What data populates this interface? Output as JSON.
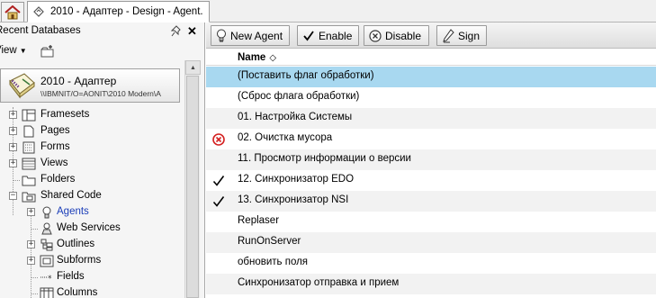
{
  "tabs": {
    "home_icon": "home-icon",
    "design_tab_label": "2010 - Адаптер - Design - Agent..."
  },
  "navigator": {
    "title": "Recent Databases",
    "view_label": "View",
    "database": {
      "name": "2010 - Адаптер",
      "path": "\\\\IBMNIT/O=AONIT\\2010 Modern\\A"
    },
    "tree": [
      {
        "label": "Framesets",
        "icon": "frameset-icon",
        "expander": "+",
        "level": 0
      },
      {
        "label": "Pages",
        "icon": "page-icon",
        "expander": "+",
        "level": 0
      },
      {
        "label": "Forms",
        "icon": "form-icon",
        "expander": "+",
        "level": 0
      },
      {
        "label": "Views",
        "icon": "view-icon",
        "expander": "+",
        "level": 0
      },
      {
        "label": "Folders",
        "icon": "folder-icon",
        "expander": "",
        "level": 0
      },
      {
        "label": "Shared Code",
        "icon": "shared-code-icon",
        "expander": "−",
        "level": 0
      },
      {
        "label": "Agents",
        "icon": "agent-bulb-icon",
        "expander": "+",
        "level": 1,
        "active": true
      },
      {
        "label": "Web Services",
        "icon": "web-services-icon",
        "expander": "",
        "level": 1
      },
      {
        "label": "Outlines",
        "icon": "outline-icon",
        "expander": "+",
        "level": 1
      },
      {
        "label": "Subforms",
        "icon": "subform-icon",
        "expander": "+",
        "level": 1
      },
      {
        "label": "Fields",
        "icon": "field-icon",
        "expander": "",
        "level": 1
      },
      {
        "label": "Columns",
        "icon": "column-icon",
        "expander": "",
        "level": 1
      }
    ]
  },
  "toolbar": {
    "new_agent": "New Agent",
    "enable": "Enable",
    "disable": "Disable",
    "sign": "Sign"
  },
  "list": {
    "column_name": "Name",
    "sort_icon": "◇",
    "rows": [
      {
        "name": "(Поставить флаг обработки)",
        "status": "",
        "selected": true
      },
      {
        "name": "(Сброс флага обработки)",
        "status": ""
      },
      {
        "name": "01. Настройка Системы",
        "status": ""
      },
      {
        "name": "02. Очистка мусора",
        "status": "disabled-icon"
      },
      {
        "name": "11. Просмотр информации о версии",
        "status": ""
      },
      {
        "name": "12. Синхронизатор EDO",
        "status": "enabled-check-icon"
      },
      {
        "name": "13. Синхронизатор NSI",
        "status": "enabled-check-icon"
      },
      {
        "name": "Replaser",
        "status": ""
      },
      {
        "name": "RunOnServer",
        "status": ""
      },
      {
        "name": "обновить поля",
        "status": ""
      },
      {
        "name": "Синхронизатор отправка и прием",
        "status": ""
      }
    ]
  },
  "colors": {
    "selected_row": "#a8d8f0",
    "alt_row": "#f2f2f2",
    "active_tree_label": "#1a3db8",
    "disabled_red": "#d42020"
  }
}
